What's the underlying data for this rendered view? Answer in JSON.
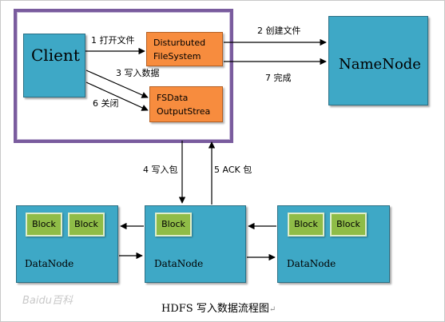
{
  "client": {
    "label": "Client"
  },
  "namenode": {
    "label": "NameNode"
  },
  "dfs_box": {
    "line1": "Disturbuted",
    "line2": "FileSystem"
  },
  "fsdata_box": {
    "line1": "FSData",
    "line2": "OutputStrea"
  },
  "steps": {
    "open_file": "1  打开文件",
    "create_file": "2  创建文件",
    "write_data": "3  写入数据",
    "write_packet": "4  写入包",
    "ack_packet": "5 ACK 包",
    "close": "6  关闭",
    "complete": "7  完成"
  },
  "datanodes": [
    {
      "label": "DataNode",
      "blocks": [
        "Block",
        "Block"
      ]
    },
    {
      "label": "DataNode",
      "blocks": [
        "Block"
      ]
    },
    {
      "label": "DataNode",
      "blocks": [
        "Block",
        "Block"
      ]
    }
  ],
  "caption": "HDFS 写入数据流程图",
  "caption_mark": "↵",
  "watermark": "Baidu百科",
  "colors": {
    "node_fill": "#3ea8c6",
    "component_fill": "#f78c3e",
    "block_fill": "#8fbc47",
    "client_border": "#7a5c9e"
  }
}
